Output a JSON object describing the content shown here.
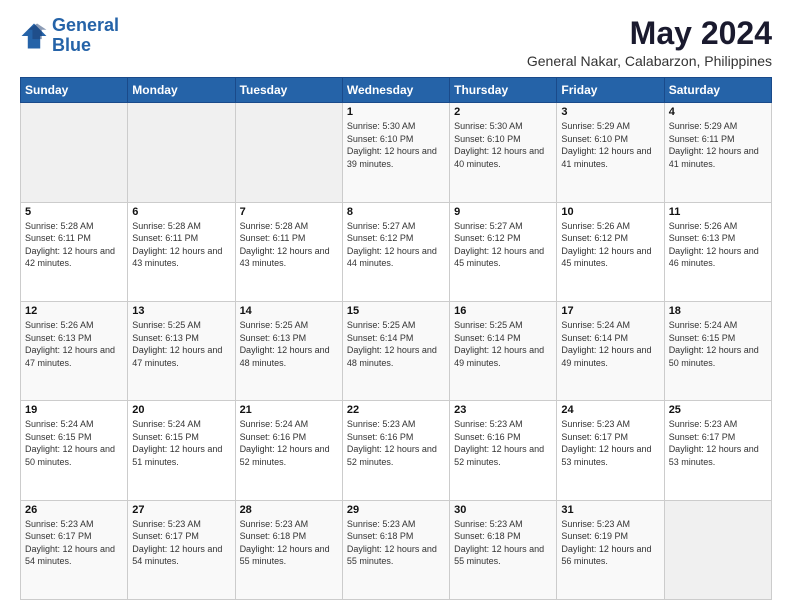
{
  "logo": {
    "line1": "General",
    "line2": "Blue"
  },
  "title": "May 2024",
  "subtitle": "General Nakar, Calabarzon, Philippines",
  "header_days": [
    "Sunday",
    "Monday",
    "Tuesday",
    "Wednesday",
    "Thursday",
    "Friday",
    "Saturday"
  ],
  "weeks": [
    [
      {
        "day": "",
        "sunrise": "",
        "sunset": "",
        "daylight": ""
      },
      {
        "day": "",
        "sunrise": "",
        "sunset": "",
        "daylight": ""
      },
      {
        "day": "",
        "sunrise": "",
        "sunset": "",
        "daylight": ""
      },
      {
        "day": "1",
        "sunrise": "Sunrise: 5:30 AM",
        "sunset": "Sunset: 6:10 PM",
        "daylight": "Daylight: 12 hours and 39 minutes."
      },
      {
        "day": "2",
        "sunrise": "Sunrise: 5:30 AM",
        "sunset": "Sunset: 6:10 PM",
        "daylight": "Daylight: 12 hours and 40 minutes."
      },
      {
        "day": "3",
        "sunrise": "Sunrise: 5:29 AM",
        "sunset": "Sunset: 6:10 PM",
        "daylight": "Daylight: 12 hours and 41 minutes."
      },
      {
        "day": "4",
        "sunrise": "Sunrise: 5:29 AM",
        "sunset": "Sunset: 6:11 PM",
        "daylight": "Daylight: 12 hours and 41 minutes."
      }
    ],
    [
      {
        "day": "5",
        "sunrise": "Sunrise: 5:28 AM",
        "sunset": "Sunset: 6:11 PM",
        "daylight": "Daylight: 12 hours and 42 minutes."
      },
      {
        "day": "6",
        "sunrise": "Sunrise: 5:28 AM",
        "sunset": "Sunset: 6:11 PM",
        "daylight": "Daylight: 12 hours and 43 minutes."
      },
      {
        "day": "7",
        "sunrise": "Sunrise: 5:28 AM",
        "sunset": "Sunset: 6:11 PM",
        "daylight": "Daylight: 12 hours and 43 minutes."
      },
      {
        "day": "8",
        "sunrise": "Sunrise: 5:27 AM",
        "sunset": "Sunset: 6:12 PM",
        "daylight": "Daylight: 12 hours and 44 minutes."
      },
      {
        "day": "9",
        "sunrise": "Sunrise: 5:27 AM",
        "sunset": "Sunset: 6:12 PM",
        "daylight": "Daylight: 12 hours and 45 minutes."
      },
      {
        "day": "10",
        "sunrise": "Sunrise: 5:26 AM",
        "sunset": "Sunset: 6:12 PM",
        "daylight": "Daylight: 12 hours and 45 minutes."
      },
      {
        "day": "11",
        "sunrise": "Sunrise: 5:26 AM",
        "sunset": "Sunset: 6:13 PM",
        "daylight": "Daylight: 12 hours and 46 minutes."
      }
    ],
    [
      {
        "day": "12",
        "sunrise": "Sunrise: 5:26 AM",
        "sunset": "Sunset: 6:13 PM",
        "daylight": "Daylight: 12 hours and 47 minutes."
      },
      {
        "day": "13",
        "sunrise": "Sunrise: 5:25 AM",
        "sunset": "Sunset: 6:13 PM",
        "daylight": "Daylight: 12 hours and 47 minutes."
      },
      {
        "day": "14",
        "sunrise": "Sunrise: 5:25 AM",
        "sunset": "Sunset: 6:13 PM",
        "daylight": "Daylight: 12 hours and 48 minutes."
      },
      {
        "day": "15",
        "sunrise": "Sunrise: 5:25 AM",
        "sunset": "Sunset: 6:14 PM",
        "daylight": "Daylight: 12 hours and 48 minutes."
      },
      {
        "day": "16",
        "sunrise": "Sunrise: 5:25 AM",
        "sunset": "Sunset: 6:14 PM",
        "daylight": "Daylight: 12 hours and 49 minutes."
      },
      {
        "day": "17",
        "sunrise": "Sunrise: 5:24 AM",
        "sunset": "Sunset: 6:14 PM",
        "daylight": "Daylight: 12 hours and 49 minutes."
      },
      {
        "day": "18",
        "sunrise": "Sunrise: 5:24 AM",
        "sunset": "Sunset: 6:15 PM",
        "daylight": "Daylight: 12 hours and 50 minutes."
      }
    ],
    [
      {
        "day": "19",
        "sunrise": "Sunrise: 5:24 AM",
        "sunset": "Sunset: 6:15 PM",
        "daylight": "Daylight: 12 hours and 50 minutes."
      },
      {
        "day": "20",
        "sunrise": "Sunrise: 5:24 AM",
        "sunset": "Sunset: 6:15 PM",
        "daylight": "Daylight: 12 hours and 51 minutes."
      },
      {
        "day": "21",
        "sunrise": "Sunrise: 5:24 AM",
        "sunset": "Sunset: 6:16 PM",
        "daylight": "Daylight: 12 hours and 52 minutes."
      },
      {
        "day": "22",
        "sunrise": "Sunrise: 5:23 AM",
        "sunset": "Sunset: 6:16 PM",
        "daylight": "Daylight: 12 hours and 52 minutes."
      },
      {
        "day": "23",
        "sunrise": "Sunrise: 5:23 AM",
        "sunset": "Sunset: 6:16 PM",
        "daylight": "Daylight: 12 hours and 52 minutes."
      },
      {
        "day": "24",
        "sunrise": "Sunrise: 5:23 AM",
        "sunset": "Sunset: 6:17 PM",
        "daylight": "Daylight: 12 hours and 53 minutes."
      },
      {
        "day": "25",
        "sunrise": "Sunrise: 5:23 AM",
        "sunset": "Sunset: 6:17 PM",
        "daylight": "Daylight: 12 hours and 53 minutes."
      }
    ],
    [
      {
        "day": "26",
        "sunrise": "Sunrise: 5:23 AM",
        "sunset": "Sunset: 6:17 PM",
        "daylight": "Daylight: 12 hours and 54 minutes."
      },
      {
        "day": "27",
        "sunrise": "Sunrise: 5:23 AM",
        "sunset": "Sunset: 6:17 PM",
        "daylight": "Daylight: 12 hours and 54 minutes."
      },
      {
        "day": "28",
        "sunrise": "Sunrise: 5:23 AM",
        "sunset": "Sunset: 6:18 PM",
        "daylight": "Daylight: 12 hours and 55 minutes."
      },
      {
        "day": "29",
        "sunrise": "Sunrise: 5:23 AM",
        "sunset": "Sunset: 6:18 PM",
        "daylight": "Daylight: 12 hours and 55 minutes."
      },
      {
        "day": "30",
        "sunrise": "Sunrise: 5:23 AM",
        "sunset": "Sunset: 6:18 PM",
        "daylight": "Daylight: 12 hours and 55 minutes."
      },
      {
        "day": "31",
        "sunrise": "Sunrise: 5:23 AM",
        "sunset": "Sunset: 6:19 PM",
        "daylight": "Daylight: 12 hours and 56 minutes."
      },
      {
        "day": "",
        "sunrise": "",
        "sunset": "",
        "daylight": ""
      }
    ]
  ]
}
